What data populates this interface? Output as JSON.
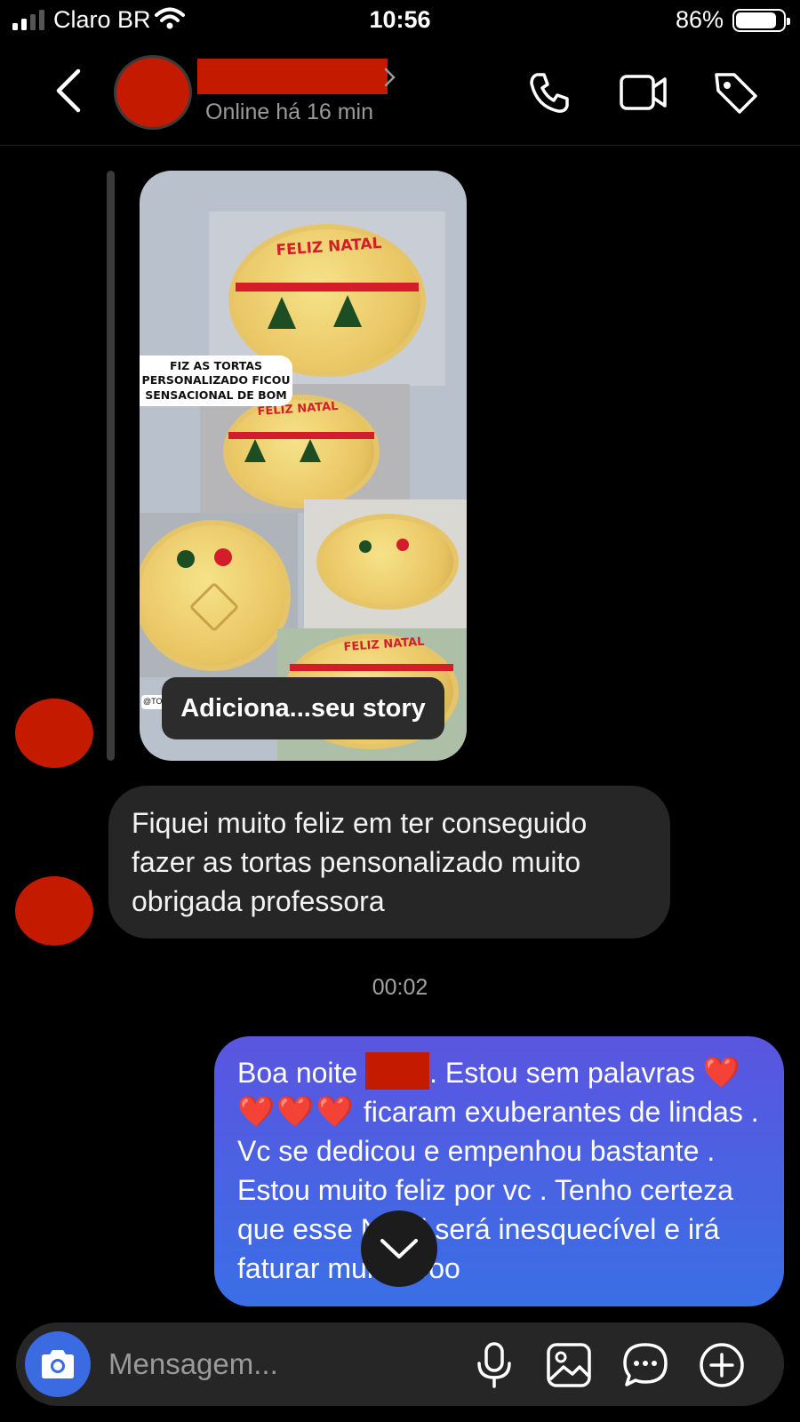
{
  "status_bar": {
    "carrier": "Claro BR",
    "time": "10:56",
    "battery_percent": "86%",
    "battery_level": 0.86,
    "icons": [
      "signal-icon",
      "wifi-icon",
      "battery-icon"
    ]
  },
  "header": {
    "status": "Online há 16 min",
    "icons": [
      "back-icon",
      "chevron-right-icon",
      "phone-icon",
      "video-camera-icon",
      "tag-icon"
    ]
  },
  "story_reply": {
    "caption_sticker": "FIZ AS TORTAS PERSONALIZADO FICOU SENSACIONAL DE BOM",
    "handle_sticker": "@TO",
    "pie_text_1": "FELIZ NATAL",
    "pie_text_2": "FELIZ NATAL",
    "pie_text_3": "FELIZ NATAL",
    "pill_label": "Adiciona...seu story"
  },
  "messages": {
    "incoming_1": "Fiquei muito feliz em ter conseguido fazer as tortas pensonalizado  muito obrigada professora",
    "timestamp": "00:02",
    "outgoing_1_a": "Boa noite ",
    "outgoing_1_b": ". Estou sem palavras",
    "outgoing_1_hearts": "❤️❤️❤️❤️",
    "outgoing_1_c": " ficaram exuberantes de lindas . Vc se dedicou e empenhou bastante . Estou muito feliz por vc . Tenho certeza que esse Natal será inesquecível e irá faturar muitooooo"
  },
  "composer": {
    "placeholder": "Mensagem...",
    "icons": [
      "camera-icon",
      "microphone-icon",
      "gallery-icon",
      "sticker-icon",
      "plus-circle-icon"
    ]
  },
  "colors": {
    "accent_blue": "#3a6be3",
    "bubble_out_top": "#5a55e0",
    "bubble_out_bottom": "#3a6fe6",
    "bubble_in": "#262626",
    "redaction": "#c41a00",
    "background": "#000000"
  }
}
